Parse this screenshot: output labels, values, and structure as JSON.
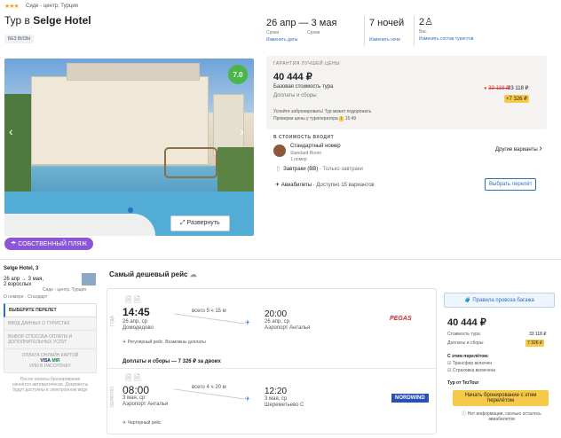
{
  "hotel": {
    "stars": "★★★",
    "location": "Сиде - центр, Турция",
    "title_prefix": "Тур в",
    "name": "Selge Hotel",
    "tag": "БЕЗ ВИЗЫ",
    "rating": "7.0",
    "expand_label": "Развернуть",
    "beach_badge": "СОБСТВЕННЫЙ ПЛЯЖ"
  },
  "trip": {
    "dates": "26 апр — 3 мая",
    "from_label": "Сроки",
    "to_label": "Сроки",
    "change_dates": "Изменить даты",
    "nights": "7 ночей",
    "change_nights": "Изменить ночи",
    "guests_icon": "2",
    "guests_label": "Вас",
    "change_guests": "Изменить состав туристов"
  },
  "price": {
    "guarantee": "ГАРАНТИЯ ЛУЧШЕЙ ЦЕНЫ",
    "amount": "40 444 ₽",
    "base_label": "Базовая стоимость тура",
    "fees_label": "Доплаты и сборы",
    "old_price": "33 118 ₽",
    "surcharge": "+7 326 ₽",
    "note1": "Успейте забронировать! Тур может подорожать",
    "note2": "Проверки цены у туроператора",
    "note_time": "15:49"
  },
  "included": {
    "heading": "В СТОИМОСТЬ ВХОДИТ",
    "room": "Стандартный номер",
    "room_en": "Standard Room",
    "room_count": "1 номер",
    "other_options": "Другие варианты",
    "meal": "Завтраки (BB)",
    "meal_note": "Только завтраки",
    "flights": "Авиабилеты",
    "flights_note": "Доступно 15 вариантов",
    "choose_flight": "Выбрать перелёт"
  },
  "sidebar": {
    "hotel": "Selge Hotel, 3",
    "dates": "26 апр",
    "dates2": "3 мая,",
    "adults": "2 взрослых",
    "city": "Сиде - центр, Турция",
    "room": "Стандарт",
    "room_pre": "О номере",
    "steps": [
      "ВЫБЕРИТЕ ПЕРЕЛЕТ",
      "ВВОД ДАННЫХ О ТУРИСТАХ",
      "ВЫБОР СПОСОБА ОПЛАТЫ И ДОПОЛНИТЕЛЬНЫХ УСЛУГ",
      "ОПЛАТА ОНЛАЙН КАРТОЙ"
    ],
    "pay_logos": [
      "VISA",
      "MIR"
    ],
    "pay_note": "ИЛИ В РАССРОЧКУ",
    "footer1": "После оплаты бронирование",
    "footer2": "начнётся автоматически. Документы",
    "footer3": "будут доступны в электронном виде"
  },
  "flight": {
    "heading": "Самый дешевый рейс",
    "there": "ТУДА",
    "back": "ОБРАТНО",
    "dep_time": "14:45",
    "dep_date": "26 апр, ср",
    "dep_airport": "Домодедово",
    "duration1": "всего 5 ч 15 м",
    "arr_time": "20:00",
    "arr_date": "26 апр, ср",
    "arr_airport": "Аэропорт Анталья",
    "type1": "Регулярный рейс. Возможны доплаты",
    "fees_line": "Доплаты и сборы — 7 326 ₽ за двоих",
    "ret_dep_time": "08:00",
    "ret_dep_date": "3 мая, ср",
    "ret_dep_airport": "Аэропорт Анталья",
    "duration2": "всего 4 ч 20 м",
    "ret_arr_time": "12:20",
    "ret_arr_date": "3 мая, ср",
    "ret_arr_airport": "Шереметьево С",
    "type2": "Чартерный рейс",
    "airline1": "PEGAS",
    "airline2": "NORDWIND"
  },
  "booking": {
    "rules": "Правила провоза багажа",
    "price": "40 444 ₽",
    "base_label": "Стоимость тура",
    "base_value": "33 118 ₽",
    "fees_label": "Доплаты и сборы",
    "fees_value": "7 326 ₽",
    "with_flight": "С этим перелётом:",
    "transfer": "Трансфер включен",
    "insurance": "Страховка включена",
    "operator": "Тур от TezTour",
    "book_btn": "Начать бронирование с этим перелётом",
    "note": "Нет информации, сколько осталось авиабилетов"
  }
}
